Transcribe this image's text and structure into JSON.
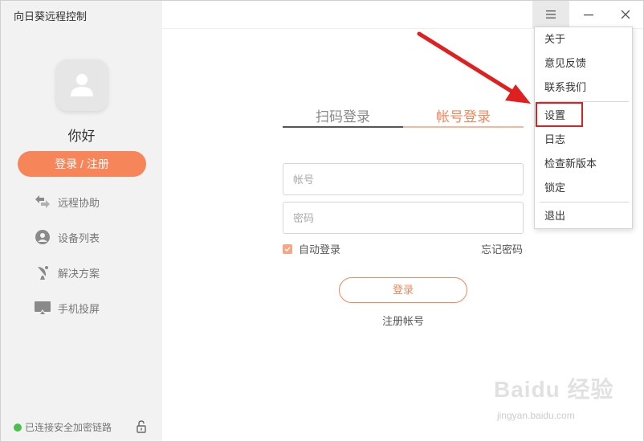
{
  "app": {
    "title": "向日葵远程控制"
  },
  "sidebar": {
    "greeting": "你好",
    "login_button": "登录 / 注册",
    "items": [
      {
        "label": "远程协助",
        "icon": "remote-assist-icon"
      },
      {
        "label": "设备列表",
        "icon": "device-list-icon"
      },
      {
        "label": "解决方案",
        "icon": "solution-icon"
      },
      {
        "label": "手机投屏",
        "icon": "screen-cast-icon"
      }
    ],
    "status": "已连接安全加密链路"
  },
  "tabs": {
    "scan": "扫码登录",
    "account": "帐号登录",
    "active": "account"
  },
  "form": {
    "account_placeholder": "帐号",
    "password_placeholder": "密码",
    "auto_login": "自动登录",
    "auto_login_checked": true,
    "forgot": "忘记密码",
    "submit": "登录",
    "register": "注册帐号"
  },
  "menu": {
    "items": [
      "关于",
      "意见反馈",
      "联系我们",
      "设置",
      "日志",
      "检查新版本",
      "锁定",
      "退出"
    ],
    "highlighted": "设置"
  },
  "colors": {
    "accent": "#f7855a",
    "status_green": "#49c04a",
    "annotation_red": "#e02020"
  },
  "watermark": {
    "text": "Baidu 经验",
    "url": "jingyan.baidu.com"
  }
}
